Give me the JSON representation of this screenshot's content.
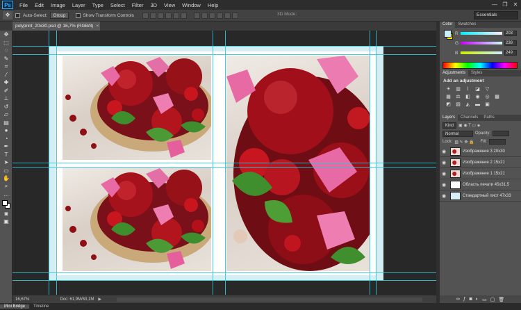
{
  "app": {
    "logo": "Ps"
  },
  "menu": [
    "File",
    "Edit",
    "Image",
    "Layer",
    "Type",
    "Select",
    "Filter",
    "3D",
    "View",
    "Window",
    "Help"
  ],
  "window_controls": [
    "—",
    "❐",
    "✕"
  ],
  "options": {
    "auto_select_label": "Auto-Select:",
    "auto_select_target": "Group",
    "transform_label": "Show Transform Controls",
    "mode_3d": "3D Mode:",
    "workspace": "Essentials"
  },
  "document": {
    "tab_title": "polyprint_20x30.psd @ 16,7% (RGB/8)",
    "close": "×"
  },
  "status": {
    "zoom": "16,67%",
    "doc": "Doc: 61,9M/63,1M",
    "arrow": "▶"
  },
  "bottom_tabs": [
    "Mini Bridge",
    "Timeline"
  ],
  "panels": {
    "color_tabs": [
      "Color",
      "Swatches"
    ],
    "color": {
      "r": "203",
      "g": "238",
      "b": "249",
      "labels": [
        "R",
        "G",
        "B"
      ],
      "fg": "#cbeefa",
      "bg": "#ffe800"
    },
    "adjust_tabs": [
      "Adjustments",
      "Styles"
    ],
    "adjust_title": "Add an adjustment",
    "layer_tabs": [
      "Layers",
      "Channels",
      "Paths"
    ],
    "layer_kind": "Kind",
    "blend_mode": "Normal",
    "opacity_label": "Opacity:",
    "lock_label": "Lock:",
    "fill_label": "Fill:",
    "layers": [
      {
        "name": "Изображение 3 20x30",
        "thumb": "red"
      },
      {
        "name": "Изображение 2 15x21",
        "thumb": "red"
      },
      {
        "name": "Изображение 1 15x21",
        "thumb": "red"
      },
      {
        "name": "Область печати 45x31,5",
        "thumb": "white"
      },
      {
        "name": "Стандартный лист 47x33",
        "thumb": "pale"
      }
    ],
    "footer_icons": [
      "link-icon",
      "fx-icon",
      "mask-icon",
      "adjustment-icon",
      "folder-icon",
      "new-layer-icon",
      "trash-icon"
    ]
  },
  "colors": {
    "guide": "#32c5d8",
    "sheet": "#d4eef3",
    "canvas_bg": "#282828"
  }
}
